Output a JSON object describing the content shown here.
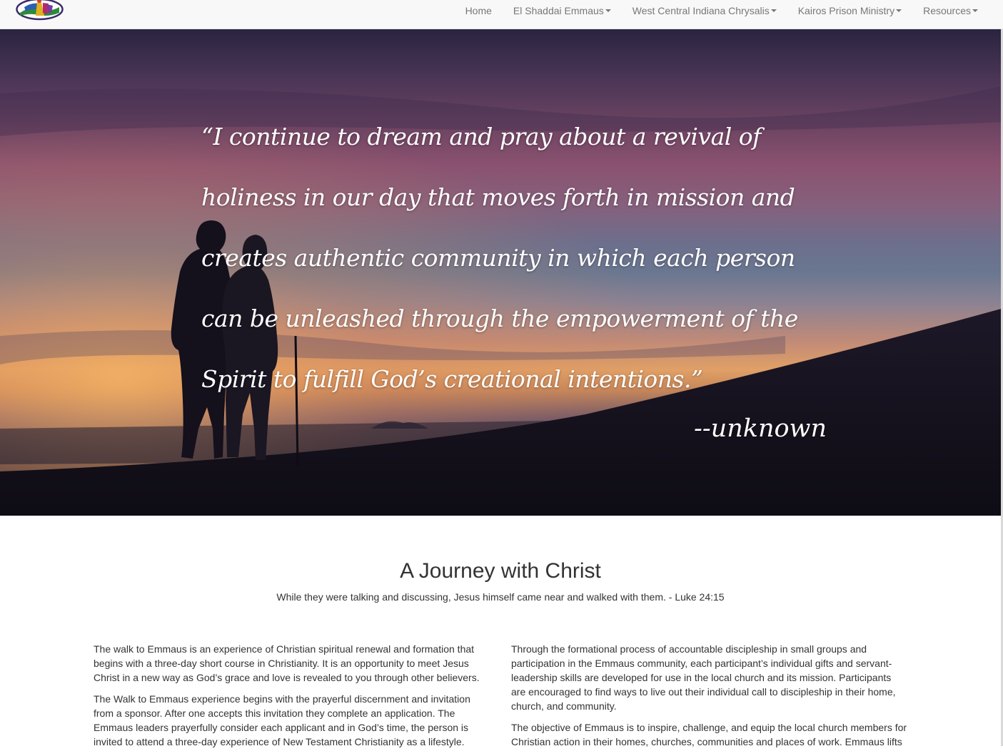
{
  "navbar": {
    "logo_alt": "logo",
    "items": [
      {
        "label": "Home",
        "dropdown": false
      },
      {
        "label": "El Shaddai Emmaus",
        "dropdown": true
      },
      {
        "label": "West Central Indiana Chrysalis",
        "dropdown": true
      },
      {
        "label": "Kairos Prison Ministry",
        "dropdown": true
      },
      {
        "label": "Resources",
        "dropdown": true
      }
    ]
  },
  "hero": {
    "quote": "“I continue to dream and pray about a revival of holiness in our day that moves forth in mission and creates authentic community in which each person can be unleashed through the empowerment of the Spirit to fulfill God’s creational intentions.”",
    "attribution": "--unknown"
  },
  "main": {
    "title": "A Journey with Christ",
    "subtitle": "While they were talking and discussing, Jesus himself came near and walked with them. - Luke 24:15",
    "left_paragraphs": [
      "The walk to Emmaus is an experience of Christian spiritual renewal and formation that begins with a three-day short course in Christianity. It is an opportunity to meet Jesus Christ in a new way as God’s grace and love is revealed to you through other believers.",
      "The Walk to Emmaus experience begins with the prayerful discernment and invitation from a sponsor.  After one accepts this invitation they complete an application.  The Emmaus leaders prayerfully consider each applicant and in God’s time, the person is invited to attend a three-day experience of New Testament Christianity as a lifestyle."
    ],
    "right_paragraphs": [
      " Through the formational process of accountable discipleship in small groups and participation in the Emmaus community, each participant’s individual gifts and servant-leadership skills are developed for use in the local church and its mission. Participants are encouraged to find ways to live out their individual call to discipleship in their home, church, and community.",
      "The objective of Emmaus is to inspire, challenge, and equip the local church members for Christian action in their homes, churches, communities and places of work.  Emmaus lifts"
    ]
  },
  "colors": {
    "navbar_bg": "#f8f8f8",
    "nav_text": "#777777",
    "body_text": "#333333",
    "quote_text": "#ffffff"
  }
}
